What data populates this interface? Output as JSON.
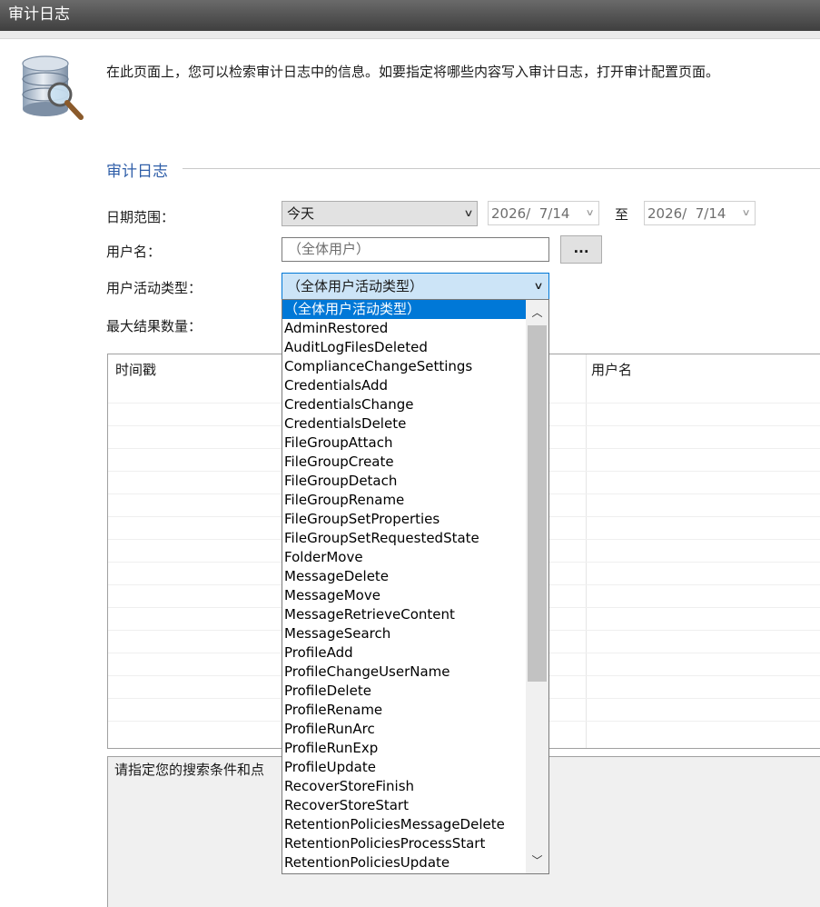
{
  "window": {
    "title": "审计日志"
  },
  "intro": {
    "text": "在此页面上，您可以检索审计日志中的信息。如要指定将哪些内容写入审计日志，打开审计配置页面。"
  },
  "group": {
    "title": "审计日志"
  },
  "form": {
    "date_range_label": "日期范围：",
    "date_range_value": "今天",
    "date_from": "2026/  7/14",
    "to_label": "至",
    "date_to": "2026/  7/14",
    "username_label": "用户名：",
    "username_placeholder": "（全体用户）",
    "browse_label": "...",
    "activity_label": "用户活动类型：",
    "activity_value": "（全体用户活动类型）",
    "max_results_label": "最大结果数量："
  },
  "table": {
    "headers": [
      "时间戳",
      "",
      "用户名"
    ]
  },
  "status": {
    "text": "请指定您的搜索条件和点"
  },
  "dropdown": {
    "selected_index": 0,
    "options": [
      "（全体用户活动类型）",
      "AdminRestored",
      "AuditLogFilesDeleted",
      "ComplianceChangeSettings",
      "CredentialsAdd",
      "CredentialsChange",
      "CredentialsDelete",
      "FileGroupAttach",
      "FileGroupCreate",
      "FileGroupDetach",
      "FileGroupRename",
      "FileGroupSetProperties",
      "FileGroupSetRequestedState",
      "FolderMove",
      "MessageDelete",
      "MessageMove",
      "MessageRetrieveContent",
      "MessageSearch",
      "ProfileAdd",
      "ProfileChangeUserName",
      "ProfileDelete",
      "ProfileRename",
      "ProfileRunArc",
      "ProfileRunExp",
      "ProfileUpdate",
      "RecoverStoreFinish",
      "RecoverStoreStart",
      "RetentionPoliciesMessageDelete",
      "RetentionPoliciesProcessStart",
      "RetentionPoliciesUpdate"
    ]
  },
  "icons": {
    "database": "database-search-icon",
    "chevron": "chevron-down-icon",
    "scroll_up": "scroll-up-icon",
    "scroll_down": "scroll-down-icon"
  },
  "colors": {
    "accent": "#0078d7",
    "group_title": "#2f5ea8",
    "titlebar": "#4f4f4f"
  }
}
